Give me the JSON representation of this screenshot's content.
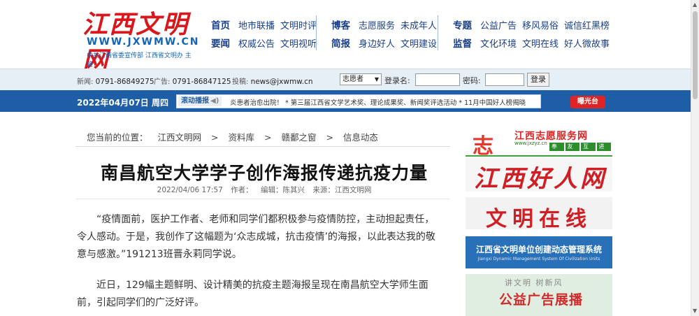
{
  "logo": {
    "cn": "江西文明网",
    "en": "WWW.JXWMW.CN",
    "sub": "中共江西省委宣传部 江西省文明办 主管"
  },
  "nav": {
    "group1": {
      "row1": {
        "head": "首页",
        "links": [
          "地市联播",
          "文明时评"
        ]
      },
      "row2": {
        "head": "要闻",
        "links": [
          "权威公告",
          "文明视听"
        ]
      }
    },
    "group2": {
      "row1": {
        "head": "博客",
        "links": [
          "志愿服务",
          "未成年人"
        ]
      },
      "row2": {
        "head": "简报",
        "links": [
          "身边好人",
          "文明建设"
        ]
      }
    },
    "group3": {
      "row1": {
        "head": "专题",
        "links": [
          "公益广告",
          "移风易俗",
          "诚信红黑榜"
        ]
      },
      "row2": {
        "head": "监督",
        "links": [
          "文化环境",
          "文明在线",
          "好人微故事"
        ]
      }
    }
  },
  "loginbar": {
    "news_label": "新闻:",
    "news_phone": "0791-86849275",
    "ad_label": "广告:",
    "ad_phone": "0791-86847125",
    "submit_label": "投稿:",
    "submit_email": "news@jxwmw.cn",
    "select_value": "志愿者",
    "username_label": "登录名:",
    "password_label": "密码:",
    "login_button": "登录"
  },
  "datebar": {
    "date": "2022年04月07日 周四",
    "scroll_label": "滚动播报",
    "scroll_text": "炎患者治愈出院！ * 第三届江西省文学艺术奖、理论成果奖、新闻奖评选活动 * 11月中国好人榜揭晓",
    "exposure_label": "曝光台"
  },
  "breadcrumb": {
    "prefix": "您当前的位置：",
    "items": [
      "江西文明网",
      ">",
      "资料库",
      ">",
      "赣鄱之窗",
      ">",
      "信息动态"
    ]
  },
  "article": {
    "title": "南昌航空大学学子创作海报传递抗疫力量",
    "datetime": "2022/04/06 17:57",
    "author_label": "作者：",
    "editor": "编辑：陈其兴",
    "source": "来源：江西文明网",
    "paragraphs": [
      "“疫情面前，医护工作者、老师和同学们都积极参与疫情防控，主动担起责任，令人感动。于是，我创作了这幅题为‘众志成城，抗击疫情’的海报，以此表达我的敬意与感激。”191213班晋永莉同学说。",
      "近日，129幅主题鲜明、设计精美的抗疫主题海报呈现在南昌航空大学师生面前，引起同学们的广泛好评。"
    ]
  },
  "sidebar": {
    "volunteer": {
      "icon": "志",
      "title": "江西志愿服务网",
      "url": "www.jxzyz.cn",
      "buttons": [
        "奉献",
        "友爱",
        "互助",
        "进步"
      ]
    },
    "goodpeople": {
      "title": "江西好人网"
    },
    "online": {
      "title": "文明在线"
    },
    "system": {
      "title": "江西省文明单位创建动态管理系统",
      "sub": "Jiangxi Dynamic Management System Of Civilization Units"
    },
    "ads": {
      "sub": "讲文明 树新风",
      "title": "公益广告展播"
    }
  },
  "colors": {
    "brand_red": "#d8181c",
    "nav_blue": "#1a3f8a",
    "bar_blue": "#1d5ea7"
  }
}
